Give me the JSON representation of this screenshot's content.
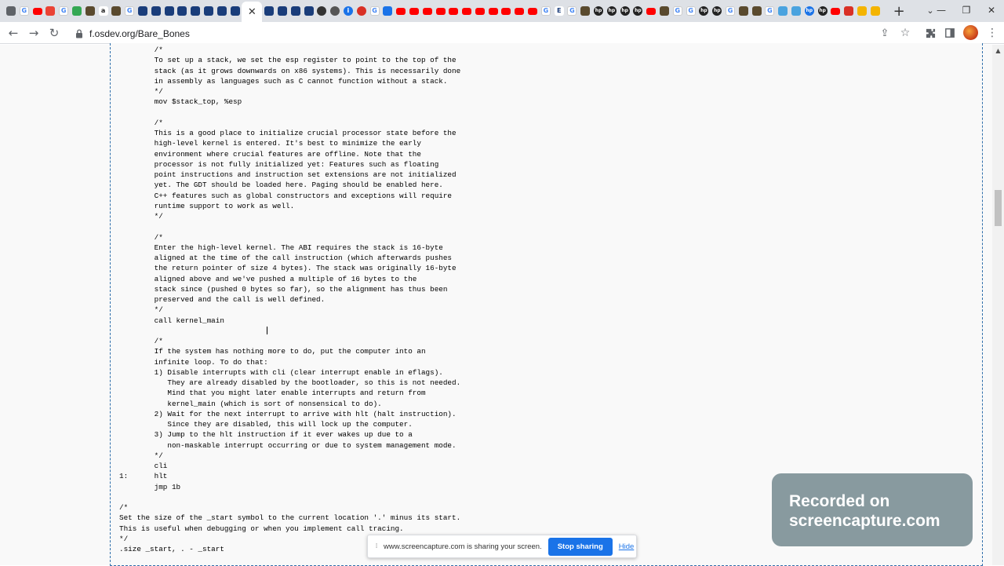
{
  "browser": {
    "url": "f.osdev.org/Bare_Bones",
    "tabs": [
      {
        "icon": "chrome-icon",
        "glyph": "",
        "color": "#5f6368"
      },
      {
        "icon": "google-icon",
        "glyph": "G",
        "color": "#4285f4"
      },
      {
        "icon": "youtube-icon",
        "glyph": "",
        "color": "#ff0000"
      },
      {
        "icon": "gmail-icon",
        "glyph": "",
        "color": "#ea4335"
      },
      {
        "icon": "google-icon",
        "glyph": "G",
        "color": "#4285f4"
      },
      {
        "icon": "bookmark-icon",
        "glyph": "",
        "color": "#34a853"
      },
      {
        "icon": "shop-icon",
        "glyph": "",
        "color": "#5a4a2e"
      },
      {
        "icon": "amazon-icon",
        "glyph": "a",
        "color": "#222222"
      },
      {
        "icon": "shop-icon",
        "glyph": "",
        "color": "#5a4a2e"
      },
      {
        "icon": "google-icon",
        "glyph": "G",
        "color": "#4285f4"
      },
      {
        "icon": "site-icon",
        "glyph": "",
        "color": "#1a3d7a"
      },
      {
        "icon": "site-icon",
        "glyph": "",
        "color": "#1a3d7a"
      },
      {
        "icon": "site-icon",
        "glyph": "",
        "color": "#1a3d7a"
      },
      {
        "icon": "site-icon",
        "glyph": "",
        "color": "#1a3d7a"
      },
      {
        "icon": "site-icon",
        "glyph": "",
        "color": "#1a3d7a"
      },
      {
        "icon": "site-icon",
        "glyph": "",
        "color": "#1a3d7a"
      },
      {
        "icon": "site-icon",
        "glyph": "",
        "color": "#1a3d7a"
      },
      {
        "icon": "site-icon",
        "glyph": "",
        "color": "#1a3d7a"
      },
      {
        "icon": "close-icon",
        "glyph": "✕",
        "color": "#ffffff",
        "active": true
      },
      {
        "icon": "site-icon",
        "glyph": "",
        "color": "#1a3d7a"
      },
      {
        "icon": "site-icon",
        "glyph": "",
        "color": "#1a3d7a"
      },
      {
        "icon": "site-icon",
        "glyph": "",
        "color": "#1a3d7a"
      },
      {
        "icon": "site-icon",
        "glyph": "",
        "color": "#1a3d7a"
      },
      {
        "icon": "github-icon",
        "glyph": "",
        "color": "#333333"
      },
      {
        "icon": "globe-icon",
        "glyph": "",
        "color": "#555555"
      },
      {
        "icon": "info-icon",
        "glyph": "i",
        "color": "#1a73e8"
      },
      {
        "icon": "record-icon",
        "glyph": "",
        "color": "#d93025"
      },
      {
        "icon": "google-icon",
        "glyph": "G",
        "color": "#4285f4"
      },
      {
        "icon": "download-icon",
        "glyph": "",
        "color": "#1a73e8"
      },
      {
        "icon": "youtube-icon",
        "glyph": "",
        "color": "#ff0000"
      },
      {
        "icon": "youtube-icon",
        "glyph": "",
        "color": "#ff0000"
      },
      {
        "icon": "youtube-icon",
        "glyph": "",
        "color": "#ff0000"
      },
      {
        "icon": "youtube-icon",
        "glyph": "",
        "color": "#ff0000"
      },
      {
        "icon": "youtube-icon",
        "glyph": "",
        "color": "#ff0000"
      },
      {
        "icon": "youtube-icon",
        "glyph": "",
        "color": "#ff0000"
      },
      {
        "icon": "youtube-icon",
        "glyph": "",
        "color": "#ff0000"
      },
      {
        "icon": "youtube-icon",
        "glyph": "",
        "color": "#ff0000"
      },
      {
        "icon": "youtube-icon",
        "glyph": "",
        "color": "#ff0000"
      },
      {
        "icon": "youtube-icon",
        "glyph": "",
        "color": "#ff0000"
      },
      {
        "icon": "youtube-icon",
        "glyph": "",
        "color": "#ff0000"
      },
      {
        "icon": "google-icon",
        "glyph": "G",
        "color": "#4285f4"
      },
      {
        "icon": "tex-icon",
        "glyph": "E",
        "color": "#1a3d7a"
      },
      {
        "icon": "google-icon",
        "glyph": "G",
        "color": "#4285f4"
      },
      {
        "icon": "shop-icon",
        "glyph": "",
        "color": "#5a4a2e"
      },
      {
        "icon": "hp-icon",
        "glyph": "hp",
        "color": "#222222"
      },
      {
        "icon": "hp-icon",
        "glyph": "hp",
        "color": "#222222"
      },
      {
        "icon": "hp-icon",
        "glyph": "hp",
        "color": "#222222"
      },
      {
        "icon": "hp-icon",
        "glyph": "hp",
        "color": "#222222"
      },
      {
        "icon": "youtube-icon",
        "glyph": "",
        "color": "#ff0000"
      },
      {
        "icon": "shop-icon",
        "glyph": "",
        "color": "#5a4a2e"
      },
      {
        "icon": "google-icon",
        "glyph": "G",
        "color": "#4285f4"
      },
      {
        "icon": "google-icon",
        "glyph": "G",
        "color": "#4285f4"
      },
      {
        "icon": "hp-icon",
        "glyph": "hp",
        "color": "#222222"
      },
      {
        "icon": "hp-icon",
        "glyph": "hp",
        "color": "#222222"
      },
      {
        "icon": "google-icon",
        "glyph": "G",
        "color": "#4285f4"
      },
      {
        "icon": "shop-icon",
        "glyph": "",
        "color": "#5a4a2e"
      },
      {
        "icon": "shop-icon",
        "glyph": "",
        "color": "#5a4a2e"
      },
      {
        "icon": "google-icon",
        "glyph": "G",
        "color": "#4285f4"
      },
      {
        "icon": "cloud-icon",
        "glyph": "",
        "color": "#4aa3df"
      },
      {
        "icon": "cloud-icon",
        "glyph": "",
        "color": "#4aa3df"
      },
      {
        "icon": "hp-icon",
        "glyph": "hp",
        "color": "#1a73e8"
      },
      {
        "icon": "hp-icon",
        "glyph": "hp",
        "color": "#222222"
      },
      {
        "icon": "youtube-icon",
        "glyph": "",
        "color": "#ff0000"
      },
      {
        "icon": "download-icon",
        "glyph": "",
        "color": "#d93025"
      },
      {
        "icon": "rainbow-icon",
        "glyph": "",
        "color": "#f4b400"
      },
      {
        "icon": "rainbow-icon",
        "glyph": "",
        "color": "#f4b400"
      }
    ]
  },
  "code_lines": [
    "        /*",
    "        To set up a stack, we set the esp register to point to the top of the",
    "        stack (as it grows downwards on x86 systems). This is necessarily done",
    "        in assembly as languages such as C cannot function without a stack.",
    "        */",
    "        mov $stack_top, %esp",
    "",
    "        /*",
    "        This is a good place to initialize crucial processor state before the",
    "        high-level kernel is entered. It's best to minimize the early",
    "        environment where crucial features are offline. Note that the",
    "        processor is not fully initialized yet: Features such as floating",
    "        point instructions and instruction set extensions are not initialized",
    "        yet. The GDT should be loaded here. Paging should be enabled here.",
    "        C++ features such as global constructors and exceptions will require",
    "        runtime support to work as well.",
    "        */",
    "",
    "        /*",
    "        Enter the high-level kernel. The ABI requires the stack is 16-byte",
    "        aligned at the time of the call instruction (which afterwards pushes",
    "        the return pointer of size 4 bytes). The stack was originally 16-byte",
    "        aligned above and we've pushed a multiple of 16 bytes to the",
    "        stack since (pushed 0 bytes so far), so the alignment has thus been",
    "        preserved and the call is well defined.",
    "        */",
    "        call kernel_main",
    "",
    "        /*",
    "        If the system has nothing more to do, put the computer into an",
    "        infinite loop. To do that:",
    "        1) Disable interrupts with cli (clear interrupt enable in eflags).",
    "           They are already disabled by the bootloader, so this is not needed.",
    "           Mind that you might later enable interrupts and return from",
    "           kernel_main (which is sort of nonsensical to do).",
    "        2) Wait for the next interrupt to arrive with hlt (halt instruction).",
    "           Since they are disabled, this will lock up the computer.",
    "        3) Jump to the hlt instruction if it ever wakes up due to a",
    "           non-maskable interrupt occurring or due to system management mode.",
    "        */",
    "        cli",
    "1:      hlt",
    "        jmp 1b",
    "",
    "/*",
    "Set the size of the _start symbol to the current location '.' minus its start.",
    "This is useful when debugging or when you implement call tracing.",
    "*/",
    ".size _start, . - _start"
  ],
  "watermark": {
    "line1": "Recorded on",
    "line2": "screencapture.com"
  },
  "sharebar": {
    "message": "www.screencapture.com is sharing your screen.",
    "stop_label": "Stop sharing",
    "hide_label": "Hide"
  }
}
